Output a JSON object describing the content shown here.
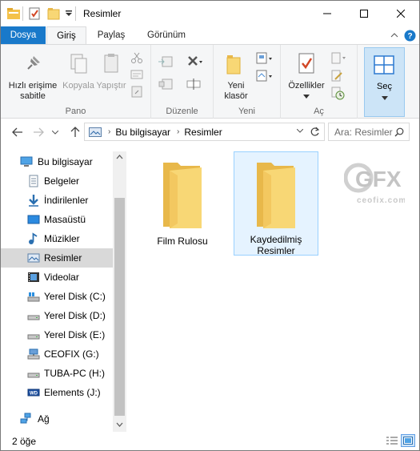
{
  "window": {
    "title": "Resimler"
  },
  "tabs": [
    {
      "label": "Dosya"
    },
    {
      "label": "Giriş"
    },
    {
      "label": "Paylaş"
    },
    {
      "label": "Görünüm"
    }
  ],
  "ribbon": {
    "groups": {
      "pano": "Pano",
      "duzenle": "Düzenle",
      "yeni": "Yeni",
      "ac": "Aç"
    },
    "buttons": {
      "pin_line1": "Hızlı erişime",
      "pin_line2": "sabitle",
      "copy": "Kopyala",
      "paste": "Yapıştır",
      "newfolder_line1": "Yeni",
      "newfolder_line2": "klasör",
      "properties": "Özellikler",
      "select": "Seç"
    }
  },
  "address": {
    "crumbs": [
      "Bu bilgisayar",
      "Resimler"
    ],
    "search_placeholder": "Ara: Resimler"
  },
  "nav": {
    "items": [
      {
        "label": "Bu bilgisayar",
        "icon": "computer-icon"
      },
      {
        "label": "Belgeler",
        "icon": "documents-icon"
      },
      {
        "label": "İndirilenler",
        "icon": "downloads-icon"
      },
      {
        "label": "Masaüstü",
        "icon": "desktop-icon"
      },
      {
        "label": "Müzikler",
        "icon": "music-icon"
      },
      {
        "label": "Resimler",
        "icon": "pictures-icon",
        "selected": true
      },
      {
        "label": "Videolar",
        "icon": "videos-icon"
      },
      {
        "label": "Yerel Disk (C:)",
        "icon": "windows-drive-icon"
      },
      {
        "label": "Yerel Disk (D:)",
        "icon": "drive-icon"
      },
      {
        "label": "Yerel Disk (E:)",
        "icon": "drive-icon"
      },
      {
        "label": "CEOFIX (G:)",
        "icon": "network-drive-icon"
      },
      {
        "label": "TUBA-PC (H:)",
        "icon": "drive-icon"
      },
      {
        "label": "Elements (J:)",
        "icon": "wd-drive-icon"
      },
      {
        "label": "Ağ",
        "icon": "network-icon"
      }
    ]
  },
  "content": {
    "folders": [
      {
        "name_line1": "Film Rulosu",
        "name_line2": ""
      },
      {
        "name_line1": "Kaydedilmiş",
        "name_line2": "Resimler",
        "selected": true
      }
    ],
    "watermark_logo": "GFX",
    "watermark_site": "ceofix.com"
  },
  "status": {
    "item_count": "2 öğe"
  },
  "colors": {
    "accent": "#1979ca",
    "folder": "#f8d775",
    "folder_dark": "#e8b84a",
    "selected_bg": "#cce4f7"
  }
}
